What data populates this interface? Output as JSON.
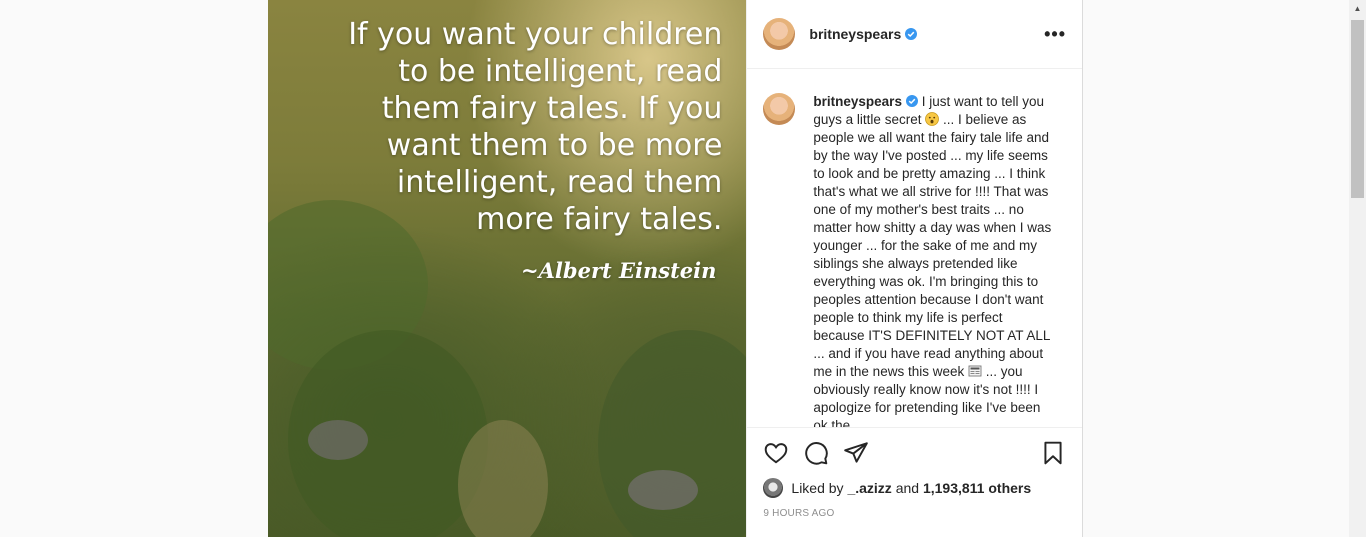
{
  "post": {
    "media": {
      "quote_lines": [
        "If you want your children",
        "to be intelligent, read",
        "them fairy tales. If you",
        "want them to be more",
        "intelligent, read them",
        "more fairy tales."
      ],
      "author": "~Albert Einstein"
    },
    "header": {
      "username": "britneyspears",
      "more_label": "•••"
    },
    "caption": {
      "username": "britneyspears",
      "text_part1": " I just want to tell you guys a little secret ",
      "text_part2": " ... I believe as people we all want the fairy tale life and by the way I've posted ... my life seems to look and be pretty amazing ... I think that's what we all strive for !!!! That was one of my mother's best traits ... no matter how shitty a day was when I was younger ... for the sake of me and my siblings she always pretended like everything was ok. I'm bringing this to peoples attention because I don't want people to think my life is perfect because IT'S DEFINITELY NOT AT ALL ... and if you have read anything about me in the news this week ",
      "text_part3": " ... you obviously really know now it's not !!!! I apologize for pretending like I've been ok the"
    },
    "likes": {
      "prefix": "Liked by ",
      "liker": "_.azizz",
      "middle": " and ",
      "count": "1,193,811 others"
    },
    "timestamp": "9 HOURS AGO"
  },
  "icons": {
    "like": "heart-icon",
    "comment": "comment-icon",
    "share": "share-icon",
    "save": "bookmark-icon",
    "verified": "verified-badge-icon"
  },
  "colors": {
    "verified_blue": "#3897f0",
    "text": "#262626",
    "muted": "#8e8e8e"
  }
}
